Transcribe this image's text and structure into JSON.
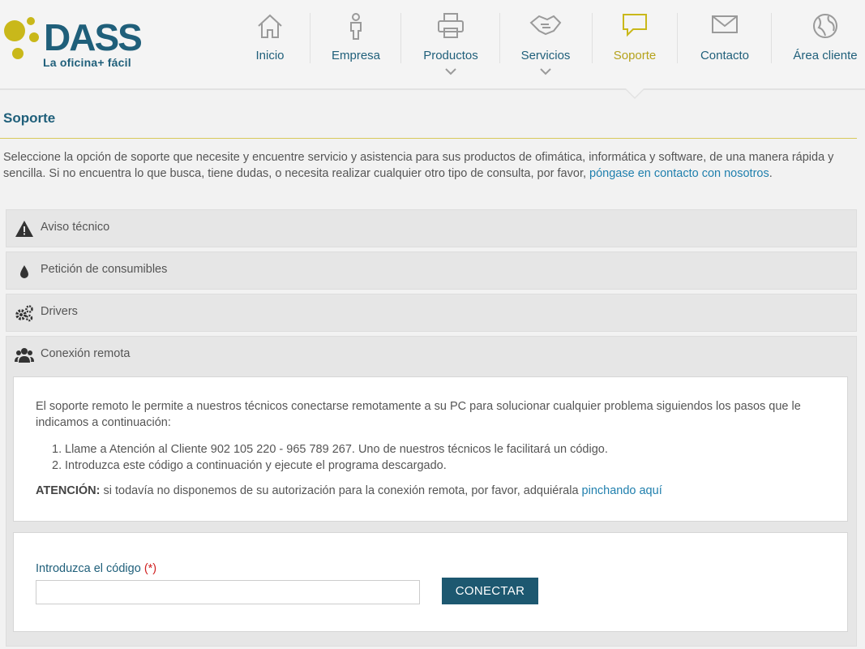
{
  "brand": {
    "name": "DASS",
    "tagline": "La oficina+ fácil",
    "colors": {
      "primary": "#1f5f7a",
      "accent": "#c9b81a",
      "button": "#1d5870",
      "link": "#1f7fad"
    }
  },
  "nav": {
    "items": [
      {
        "label": "Inicio",
        "icon": "home-icon",
        "dropdown": false,
        "active": false
      },
      {
        "label": "Empresa",
        "icon": "person-icon",
        "dropdown": false,
        "active": false
      },
      {
        "label": "Productos",
        "icon": "printer-icon",
        "dropdown": true,
        "active": false
      },
      {
        "label": "Servicios",
        "icon": "handshake-icon",
        "dropdown": true,
        "active": false
      },
      {
        "label": "Soporte",
        "icon": "speech-bubble-icon",
        "dropdown": false,
        "active": true
      },
      {
        "label": "Contacto",
        "icon": "envelope-icon",
        "dropdown": false,
        "active": false
      },
      {
        "label": "Área cliente",
        "icon": "globe-icon",
        "dropdown": false,
        "active": false
      }
    ]
  },
  "page": {
    "title": "Soporte",
    "intro": "Seleccione la opción de soporte que necesite y encuentre servicio y asistencia para sus productos de ofimática, informática y software, de una manera rápida y sencilla. Si no encuentra lo que busca, tiene dudas, o necesita realizar cualquier otro tipo de consulta, por favor,",
    "intro_link": "póngase en contacto con nosotros",
    "intro_end": "."
  },
  "accordion": [
    {
      "label": "Aviso técnico",
      "icon": "warning-icon"
    },
    {
      "label": "Petición de consumibles",
      "icon": "drop-icon"
    },
    {
      "label": "Drivers",
      "icon": "gears-icon"
    },
    {
      "label": "Conexión remota",
      "icon": "users-icon",
      "open": true
    }
  ],
  "remote": {
    "description": "El soporte remoto le permite a nuestros técnicos conectarse remotamente a su PC para solucionar cualquier problema siguiendos los pasos que le indicamos a continuación:",
    "steps": [
      {
        "num": "1.",
        "text": "Llame a Atención al Cliente 902 105 220 - 965 789 267. Uno de nuestros técnicos le facilitará un código."
      },
      {
        "num": "2.",
        "text": "Introduzca este código a continuación y ejecute el programa descargado."
      }
    ],
    "warning_label": "ATENCIÓN:",
    "warning_text": "si todavía no disponemos de su autorización para la conexión remota, por favor, adquiérala",
    "warning_link": "pinchando aquí"
  },
  "form": {
    "label": "Introduzca el código",
    "required_mark": "(*)",
    "input_value": "",
    "button_label": "CONECTAR"
  }
}
